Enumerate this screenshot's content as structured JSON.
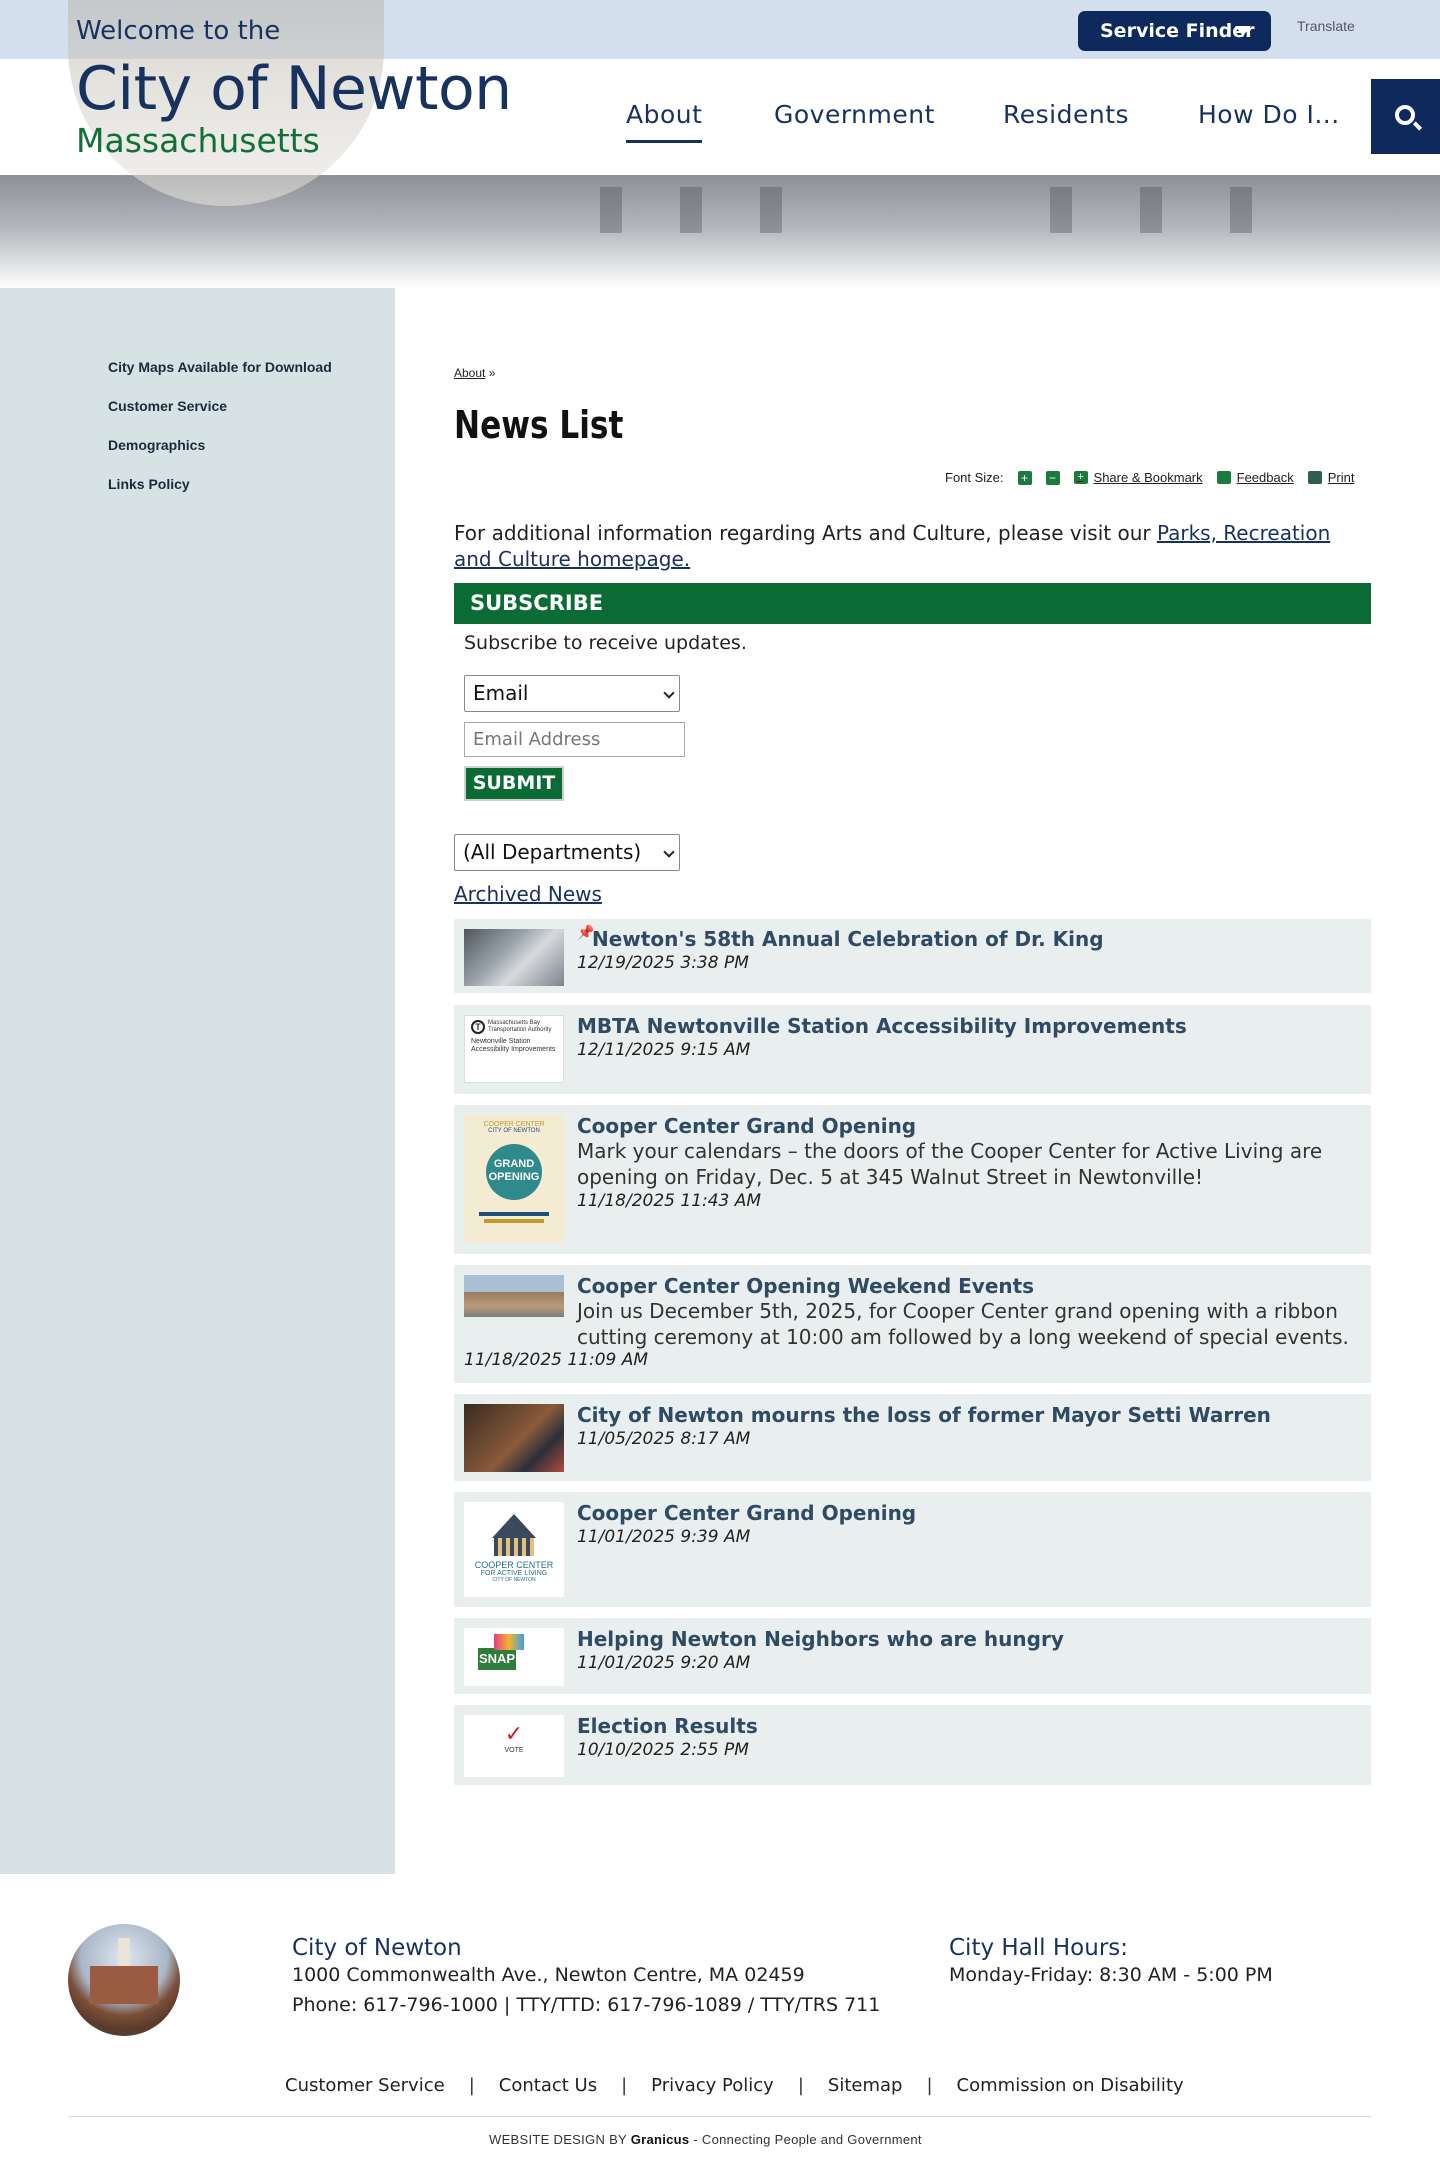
{
  "top_bar": {
    "welcome": "Welcome to the",
    "service_finder": "Service Finder",
    "translate": "Translate"
  },
  "logo": {
    "title": "City of Newton",
    "subtitle": "Massachusetts"
  },
  "nav": {
    "items": [
      "About",
      "Government",
      "Residents",
      "How Do I..."
    ],
    "active": "About"
  },
  "sidebar": {
    "items": [
      {
        "label": "City Maps Available for Download"
      },
      {
        "label": "Customer Service"
      },
      {
        "label": "Demographics"
      },
      {
        "label": "Links Policy"
      }
    ]
  },
  "breadcrumb": {
    "link": "About",
    "sep": "»"
  },
  "page": {
    "title": "News List"
  },
  "tools": {
    "font_size": "Font Size:",
    "share": "Share & Bookmark",
    "feedback": "Feedback",
    "print": "Print"
  },
  "intro": {
    "text": "For additional information regarding Arts and Culture, please visit our ",
    "link": "Parks, Recreation and Culture homepage."
  },
  "subscribe": {
    "heading": "SUBSCRIBE",
    "text": "Subscribe to receive updates.",
    "method": "Email",
    "email_placeholder": "Email Address",
    "submit": "SUBMIT"
  },
  "filter": {
    "department": "(All Departments)"
  },
  "archived_link": "Archived News",
  "news": [
    {
      "title": "Newton's 58th Annual Celebration of Dr. King",
      "date": "12/19/2025 3:38 PM",
      "pinned": true
    },
    {
      "title": "MBTA Newtonville Station Accessibility Improvements",
      "date": "12/11/2025 9:15 AM"
    },
    {
      "title": "Cooper Center Grand Opening",
      "desc": "Mark your calendars – the doors of the Cooper Center for Active Living are opening on Friday, Dec. 5 at 345 Walnut Street in Newtonville!",
      "date": "11/18/2025 11:43 AM"
    },
    {
      "title": "Cooper Center Opening Weekend Events",
      "desc": "Join us December 5th, 2025, for Cooper Center grand opening with a ribbon cutting ceremony at 10:00 am followed by a long weekend of special events.",
      "date": "11/18/2025 11:09 AM"
    },
    {
      "title": "City of Newton mourns the loss of former Mayor Setti Warren",
      "date": "11/05/2025 8:17 AM"
    },
    {
      "title": "Cooper Center Grand Opening",
      "date": "11/01/2025 9:39 AM"
    },
    {
      "title": "Helping Newton Neighbors who are hungry",
      "date": "11/01/2025 9:20 AM"
    },
    {
      "title": "Election Results",
      "date": "10/10/2025 2:55 PM"
    }
  ],
  "thumbnails": {
    "mbta_line1": "Massachusetts Bay",
    "mbta_line2": "Transportation Authority",
    "mbta_line3": "Newtonville Station",
    "mbta_line4": "Accessibility Improvements",
    "cooper_top": "COOPER CENTER",
    "cooper_city": "CITY OF NEWTON",
    "grand": "GRAND",
    "opening": "OPENING",
    "cooper_logo_1": "COOPER CENTER",
    "cooper_logo_2": "FOR ACTIVE LIVING",
    "cooper_logo_3": "CITY OF NEWTON",
    "snap": "SNAP",
    "vote": "VOTE"
  },
  "footer": {
    "org": "City of Newton",
    "address": "1000 Commonwealth Ave., Newton Centre, MA 02459",
    "phone": "Phone: 617-796-1000 | TTY/TTD: 617-796-1089 / TTY/TRS 711",
    "hours_title": "City Hall Hours:",
    "hours": "Monday-Friday: 8:30 AM - 5:00 PM",
    "links": [
      "Customer Service",
      "Contact Us",
      "Privacy Policy",
      "Sitemap",
      "Commission on Disability"
    ],
    "credit_prefix": "WEBSITE DESIGN BY ",
    "credit_brand": "Granicus",
    "credit_suffix": " - Connecting People and Government"
  },
  "colors": {
    "navy": "#17325e",
    "green": "#0b6b35",
    "sidebar_bg": "#d7e2e4",
    "news_bg": "#e9efef",
    "top_bar_bg": "#d4dfee"
  }
}
